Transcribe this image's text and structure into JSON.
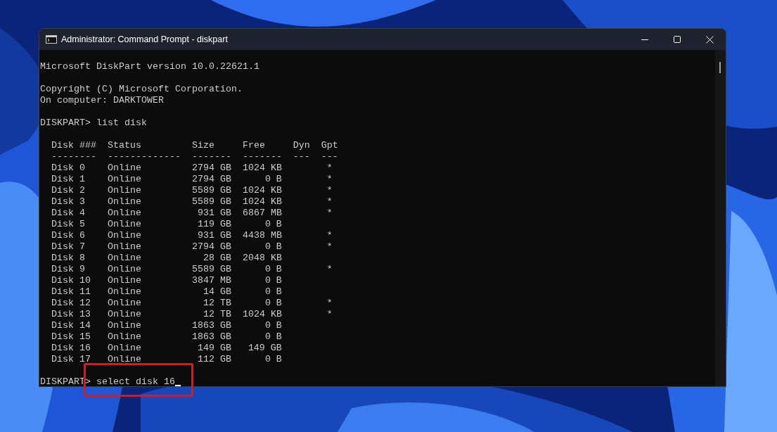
{
  "window": {
    "title": "Administrator: Command Prompt - diskpart"
  },
  "console": {
    "intro": [
      [
        "Microsoft DiskPart version 10.0.22621.1"
      ],
      [
        "Copyright (C) Microsoft Corporation.",
        "On computer: DARKTOWER"
      ]
    ],
    "command_1": {
      "prompt": "DISKPART>",
      "command": "list disk"
    },
    "table": {
      "columns": [
        "Disk ###",
        "Status",
        "Size",
        "Free",
        "Dyn",
        "Gpt"
      ],
      "separators": [
        "--------",
        "-------------",
        "-------",
        "-------",
        "---",
        "---"
      ],
      "rows": [
        {
          "disk": "Disk 0",
          "status": "Online",
          "size": "2794 GB",
          "free": "1024 KB",
          "gpt": "*"
        },
        {
          "disk": "Disk 1",
          "status": "Online",
          "size": "2794 GB",
          "free": "0 B",
          "gpt": "*"
        },
        {
          "disk": "Disk 2",
          "status": "Online",
          "size": "5589 GB",
          "free": "1024 KB",
          "gpt": "*"
        },
        {
          "disk": "Disk 3",
          "status": "Online",
          "size": "5589 GB",
          "free": "1024 KB",
          "gpt": "*"
        },
        {
          "disk": "Disk 4",
          "status": "Online",
          "size": "931 GB",
          "free": "6867 MB",
          "gpt": "*"
        },
        {
          "disk": "Disk 5",
          "status": "Online",
          "size": "119 GB",
          "free": "0 B"
        },
        {
          "disk": "Disk 6",
          "status": "Online",
          "size": "931 GB",
          "free": "4438 MB",
          "gpt": "*"
        },
        {
          "disk": "Disk 7",
          "status": "Online",
          "size": "2794 GB",
          "free": "0 B",
          "gpt": "*"
        },
        {
          "disk": "Disk 8",
          "status": "Online",
          "size": "28 GB",
          "free": "2048 KB"
        },
        {
          "disk": "Disk 9",
          "status": "Online",
          "size": "5589 GB",
          "free": "0 B",
          "gpt": "*"
        },
        {
          "disk": "Disk 10",
          "status": "Online",
          "size": "3847 MB",
          "free": "0 B"
        },
        {
          "disk": "Disk 11",
          "status": "Online",
          "size": "14 GB",
          "free": "0 B"
        },
        {
          "disk": "Disk 12",
          "status": "Online",
          "size": "12 TB",
          "free": "0 B",
          "gpt": "*"
        },
        {
          "disk": "Disk 13",
          "status": "Online",
          "size": "12 TB",
          "free": "1024 KB",
          "gpt": "*"
        },
        {
          "disk": "Disk 14",
          "status": "Online",
          "size": "1863 GB",
          "free": "0 B"
        },
        {
          "disk": "Disk 15",
          "status": "Online",
          "size": "1863 GB",
          "free": "0 B"
        },
        {
          "disk": "Disk 16",
          "status": "Online",
          "size": "149 GB",
          "free": "149 GB"
        },
        {
          "disk": "Disk 17",
          "status": "Online",
          "size": "112 GB",
          "free": "0 B"
        }
      ]
    },
    "command_2": {
      "prompt": "DISKPART>",
      "command": "select disk 16",
      "highlighted": true
    }
  }
}
